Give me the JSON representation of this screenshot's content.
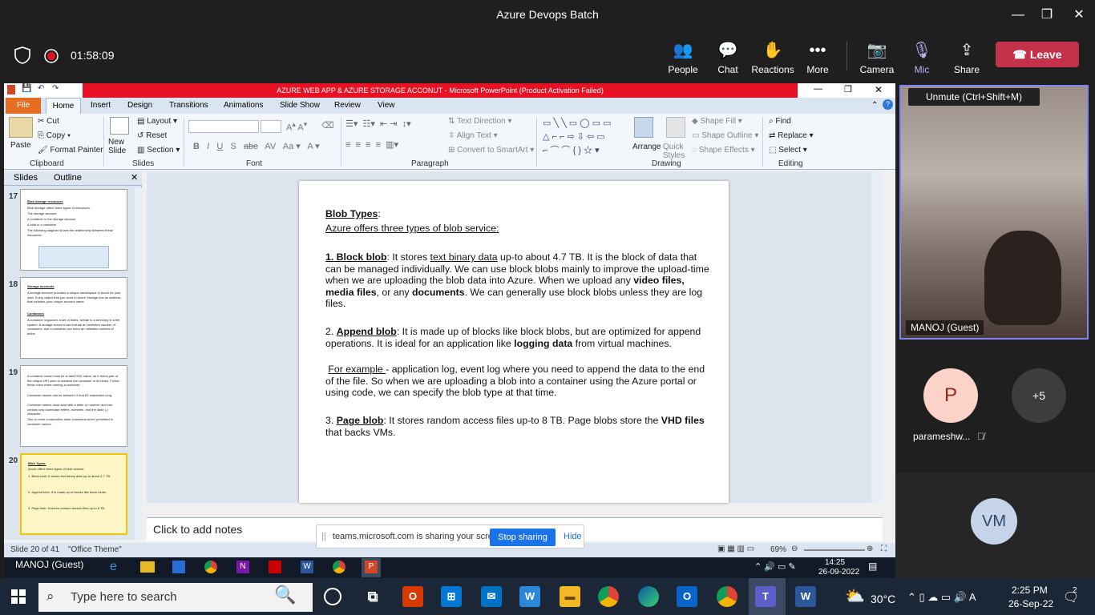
{
  "teams": {
    "window_title": "Azure Devops Batch",
    "timer": "01:58:09",
    "toolbar": {
      "people": "People",
      "chat": "Chat",
      "reactions": "Reactions",
      "more": "More",
      "camera": "Camera",
      "mic": "Mic",
      "share": "Share",
      "leave": "Leave"
    },
    "tooltip": "Unmute (Ctrl+Shift+M)",
    "participants": {
      "video_name": "MANOJ (Guest)",
      "p_initial": "P",
      "p_name": "parameshw...",
      "more_count": "+5",
      "vm_initials": "VM"
    },
    "accent": "#c4314b"
  },
  "ppt": {
    "title": "AZURE WEB APP & AZURE STORAGE ACCONUT  -  Microsoft PowerPoint (Product Activation Failed)",
    "tabs": [
      "File",
      "Home",
      "Insert",
      "Design",
      "Transitions",
      "Animations",
      "Slide Show",
      "Review",
      "View"
    ],
    "ribbon": {
      "paste": "Paste",
      "cut": "Cut",
      "copy": "Copy",
      "format_painter": "Format Painter",
      "clipboard": "Clipboard",
      "new_slide": "New Slide",
      "layout": "Layout",
      "reset": "Reset",
      "section": "Section",
      "slides": "Slides",
      "font": "Font",
      "text_direction": "Text Direction",
      "align_text": "Align Text",
      "convert_smartart": "Convert to SmartArt",
      "paragraph": "Paragraph",
      "arrange": "Arrange",
      "quick_styles": "Quick Styles",
      "shape_fill": "Shape Fill",
      "shape_outline": "Shape Outline",
      "shape_effects": "Shape Effects",
      "drawing": "Drawing",
      "find": "Find",
      "replace": "Replace",
      "select": "Select",
      "editing": "Editing"
    },
    "pane_tabs": {
      "slides": "Slides",
      "outline": "Outline"
    },
    "thumbs": [
      {
        "num": "17",
        "title": "Blob storage resources",
        "lines": [
          "Blob storage offers three types of resources:",
          "The storage account",
          "A container in the storage account",
          "A blob in a container",
          "The following diagram shows the relationship between these resources."
        ]
      },
      {
        "num": "18",
        "title": "Storage accounts",
        "lines": [
          "A storage account provides a unique namespace in Azure for your data. Every object that you store in Azure Storage has an address that includes your unique account name.",
          "Containers",
          "A container organizes a set of blobs, similar to a directory in a file system. A storage account can include an unlimited number of containers, and a container can store an unlimited number of blobs."
        ]
      },
      {
        "num": "19",
        "title": "",
        "lines": [
          "A container name must be a valid DNS name, as it forms part of the unique URI used to address the container or its blobs. Follow these rules when naming a container:",
          "Container names can be between 3 and 63 characters long.",
          "Container names must start with a letter or number, and can contain only lowercase letters, numbers, and the dash (-) character.",
          "Two or more consecutive dash characters aren't permitted in container names."
        ]
      },
      {
        "num": "20",
        "title": "Blob Types:",
        "lines": [
          "Azure offers three types of blob service:",
          "1. Block blob: It stores text binary data up-to about 4.7 TB.",
          "2. Append blob: It is made up of blocks like block blobs.",
          "3. Page blob: It stores random access files up-to 8 TB."
        ]
      }
    ],
    "slide": {
      "heading": "Blob Types",
      "colon": ":",
      "intro": "Azure offers three types of blob service:",
      "p1_label": "1. Block blob",
      "p1_a": ": It stores ",
      "p1_u": "text binary data",
      "p1_b": " up-to about 4.7 TB. It is the block of data that can be managed individually.  We can use block blobs mainly to improve the upload-time when we are uploading the blob data into Azure. When we upload any ",
      "p1_bold": "video files, media files",
      "p1_c": ", or any ",
      "p1_bold2": "documents",
      "p1_d": ". We can generally use block blobs unless they are log files.",
      "p2_num": "2. ",
      "p2_label": "Append blob",
      "p2_a": ": It is made up of blocks like block blobs, but are optimized for append operations. It is ideal for an application like ",
      "p2_bold": "logging data",
      "p2_b": " from virtual machines.",
      "p2_ex": "For example ",
      "p2_c": "- application log, event log where you need to append the data to the end of the file. So when we are uploading a blob into a container using the Azure portal or using code, we can specify the blob type at that time.",
      "p3_num": "3. ",
      "p3_label": "Page blob",
      "p3_a": ": It stores random access files up-to 8 TB. Page blobs store the ",
      "p3_bold": "VHD files",
      "p3_b": " that backs VMs."
    },
    "notes_placeholder": "Click to add notes",
    "status": {
      "slide_count": "Slide 20 of 41",
      "theme": "\"Office Theme\"",
      "zoom": "69%"
    },
    "inner_task": {
      "time": "14:25",
      "date": "26-09-2022",
      "guest_overlay": "MANOJ (Guest)"
    }
  },
  "share_banner": {
    "text": "teams.microsoft.com is sharing your screen.",
    "stop": "Stop sharing",
    "hide": "Hide"
  },
  "windows": {
    "search_placeholder": "Type here to search",
    "weather": "30°C",
    "time": "2:25 PM",
    "date": "26-Sep-22",
    "notifications": "2"
  }
}
